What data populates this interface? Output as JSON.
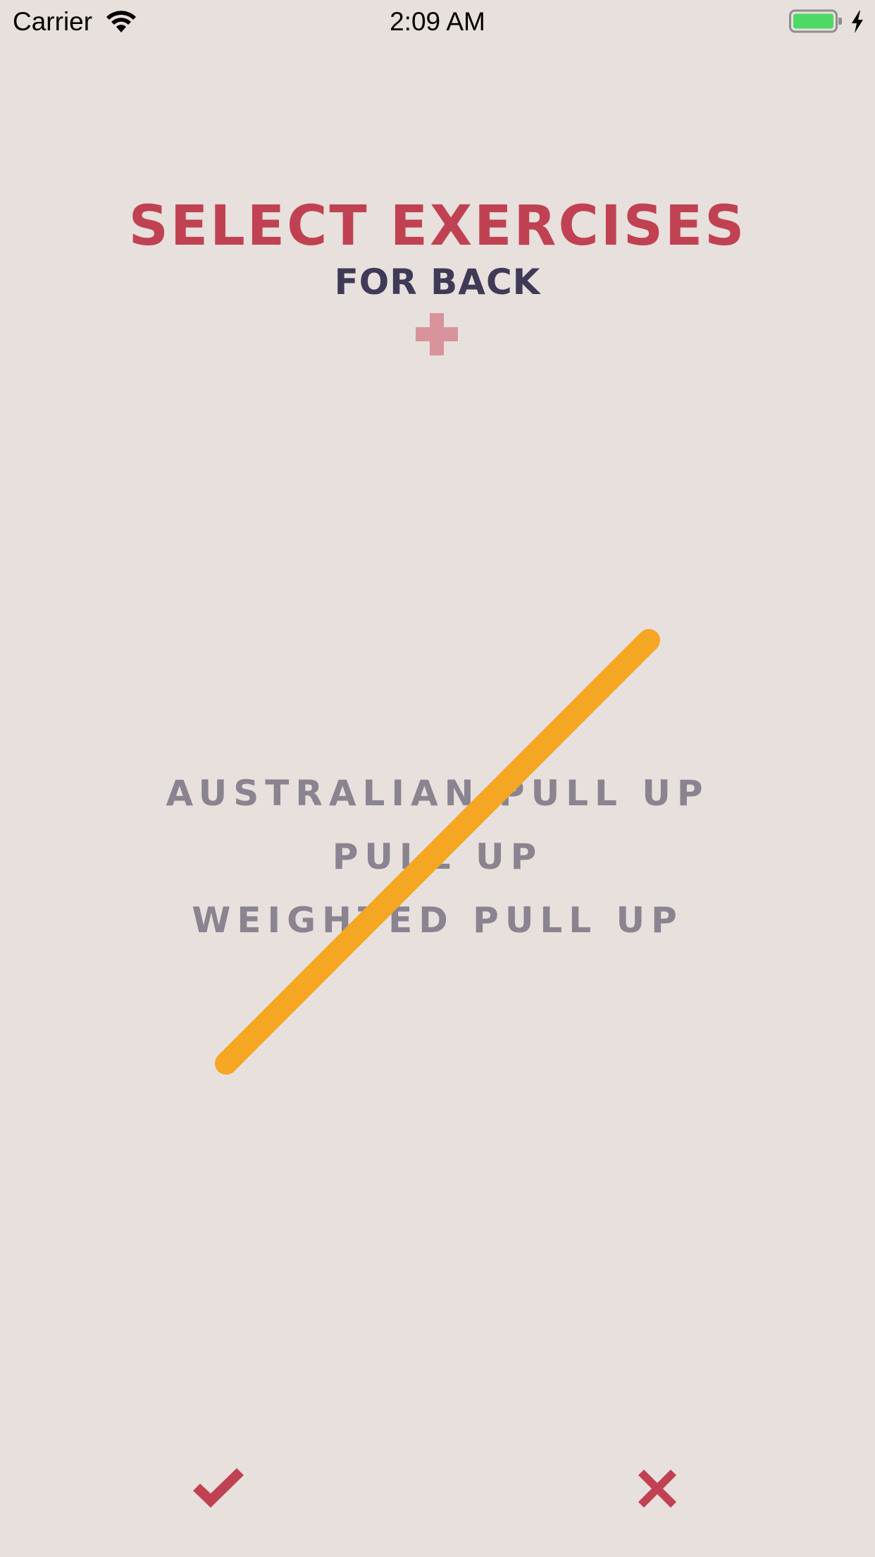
{
  "status_bar": {
    "carrier": "Carrier",
    "time": "2:09 AM",
    "battery_color": "#4cd964"
  },
  "header": {
    "title": "SELECT EXERCISES",
    "subtitle": "FOR BACK",
    "add_icon": "plus-icon",
    "title_color": "#c04252",
    "subtitle_color": "#3f3a57",
    "add_color": "#d9939b"
  },
  "exercises": [
    {
      "label": "AUSTRALIAN PULL UP"
    },
    {
      "label": "PULL UP"
    },
    {
      "label": "WEIGHTED PULL UP"
    }
  ],
  "exercise_color": "#8a8490",
  "swipe_line_color": "#f5a623",
  "footer": {
    "confirm_icon": "checkmark-icon",
    "cancel_icon": "close-icon",
    "icon_color": "#c04252"
  }
}
